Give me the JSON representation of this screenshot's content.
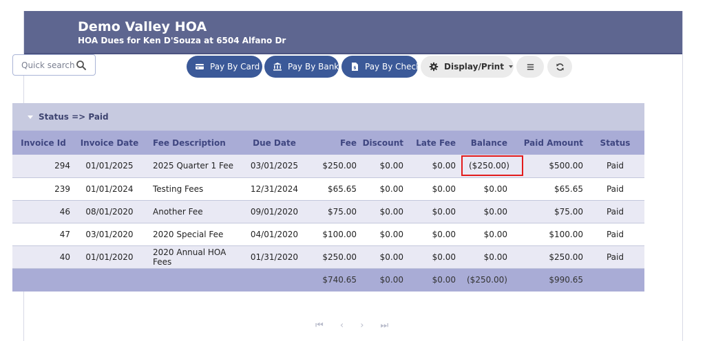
{
  "header": {
    "title": "Demo Valley HOA",
    "subtitle": "HOA Dues for Ken D'Souza at 6504 Alfano Dr"
  },
  "toolbar": {
    "search_placeholder": "Quick search",
    "pay_by_card": "Pay By Card",
    "pay_by_bank": "Pay By Bank",
    "pay_by_check": "Pay By Check",
    "display_print": "Display/Print"
  },
  "group": {
    "label": "Status => Paid"
  },
  "columns": [
    "Invoice Id",
    "Invoice Date",
    "Fee Description",
    "Due Date",
    "Fee",
    "Discount",
    "Late Fee",
    "Balance",
    "Paid Amount",
    "Status"
  ],
  "rows": [
    [
      "294",
      "01/01/2025",
      "2025 Quarter 1 Fee",
      "03/01/2025",
      "$250.00",
      "$0.00",
      "$0.00",
      "($250.00)",
      "$500.00",
      "Paid"
    ],
    [
      "239",
      "01/01/2024",
      "Testing Fees",
      "12/31/2024",
      "$65.65",
      "$0.00",
      "$0.00",
      "$0.00",
      "$65.65",
      "Paid"
    ],
    [
      "46",
      "08/01/2020",
      "Another Fee",
      "09/01/2020",
      "$75.00",
      "$0.00",
      "$0.00",
      "$0.00",
      "$75.00",
      "Paid"
    ],
    [
      "47",
      "03/01/2020",
      "2020 Special Fee",
      "04/01/2020",
      "$100.00",
      "$0.00",
      "$0.00",
      "$0.00",
      "$100.00",
      "Paid"
    ],
    [
      "40",
      "01/01/2020",
      "2020 Annual HOA Fees",
      "01/31/2020",
      "$250.00",
      "$0.00",
      "$0.00",
      "$0.00",
      "$250.00",
      "Paid"
    ]
  ],
  "totals": {
    "fee": "$740.65",
    "discount": "$0.00",
    "late_fee": "$0.00",
    "balance": "($250.00)",
    "paid_amount": "$990.65"
  },
  "pager": {
    "first": "⏮",
    "prev": "‹",
    "next": "›",
    "last": "⏭"
  },
  "colors": {
    "header_bg": "#5e6690",
    "button_blue": "#3b5998",
    "column_header_bg": "#a9acd6",
    "alt_row_bg": "#e9e9f4",
    "highlight_border": "#e21b1b"
  }
}
